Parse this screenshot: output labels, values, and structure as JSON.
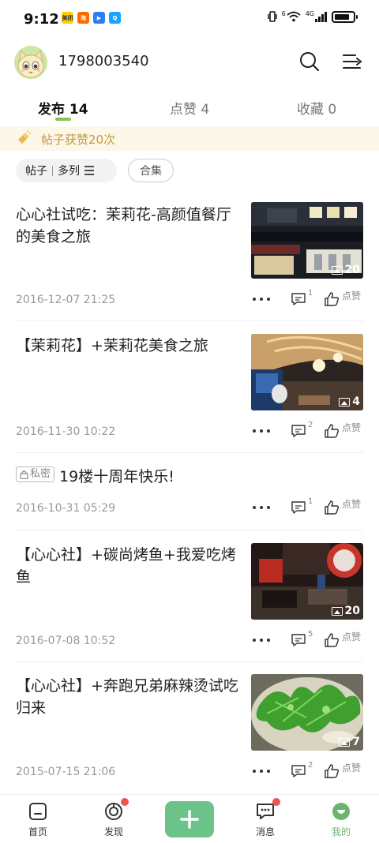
{
  "status_bar": {
    "time": "9:12",
    "apps": [
      {
        "icon": "meituan-app-icon",
        "color": "#ffd000",
        "label": "美团"
      },
      {
        "icon": "taobao-app-icon",
        "color": "#ff6a00",
        "label": "淘"
      },
      {
        "icon": "arrow-app-icon",
        "color": "#2f7cf6",
        "label": "▶"
      },
      {
        "icon": "search-app-icon",
        "color": "#1aa3ff",
        "label": "Q"
      }
    ],
    "network_label": "4G",
    "wifi_label": "6"
  },
  "header": {
    "username": "1798003540"
  },
  "tabs": [
    {
      "label": "发布 14",
      "active": true
    },
    {
      "label": "点赞 4",
      "active": false
    },
    {
      "label": "收藏 0",
      "active": false
    }
  ],
  "likes_banner": {
    "text": "帖子获赞20次"
  },
  "filters": {
    "chip1_a": "帖子",
    "chip1_b": "多列",
    "chip2": "合集"
  },
  "posts": [
    {
      "title": "心心社试吃：茉莉花-高颜值餐厅的美食之旅",
      "date": "2016-12-07 21:25",
      "comments": "1",
      "like_label": "点赞",
      "image_count": "20",
      "private": false
    },
    {
      "title": "【茉莉花】+茉莉花美食之旅",
      "date": "2016-11-30 10:22",
      "comments": "2",
      "like_label": "点赞",
      "image_count": "4",
      "private": false
    },
    {
      "title": "19楼十周年快乐!",
      "date": "2016-10-31 05:29",
      "comments": "1",
      "like_label": "点赞",
      "image_count": "",
      "private": true,
      "private_label": "私密"
    },
    {
      "title": "【心心社】+碳尚烤鱼+我爱吃烤鱼",
      "date": "2016-07-08 10:52",
      "comments": "5",
      "like_label": "点赞",
      "image_count": "20",
      "private": false
    },
    {
      "title": "【心心社】+奔跑兄弟麻辣烫试吃归来",
      "date": "2015-07-15 21:06",
      "comments": "2",
      "like_label": "点赞",
      "image_count": "7",
      "private": false
    }
  ],
  "bottom_nav": [
    {
      "label": "首页",
      "icon": "home-icon"
    },
    {
      "label": "发现",
      "icon": "discover-icon",
      "badge": true
    },
    {
      "label": "",
      "icon": "add-icon"
    },
    {
      "label": "消息",
      "icon": "message-icon",
      "badge": true
    },
    {
      "label": "我的",
      "icon": "profile-icon",
      "active": true
    }
  ],
  "colors": {
    "accent_green": "#8bc34a",
    "nav_active": "#6db36f",
    "add_button": "#6cc38a",
    "banner_text": "#c49a3c",
    "badge_red": "#ef5350"
  }
}
